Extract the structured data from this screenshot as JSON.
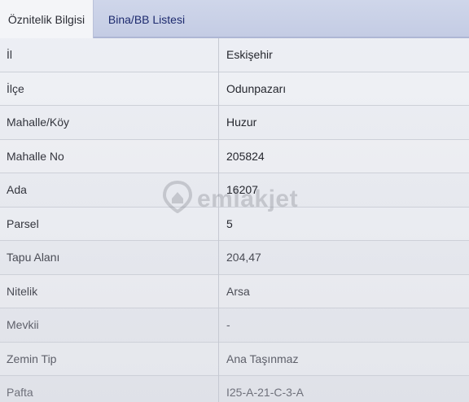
{
  "tabs": [
    {
      "label": "Öznitelik Bilgisi",
      "active": true
    },
    {
      "label": "Bina/BB Listesi",
      "active": false
    }
  ],
  "attributes": [
    {
      "label": "İl",
      "value": "Eskişehir"
    },
    {
      "label": "İlçe",
      "value": "Odunpazarı"
    },
    {
      "label": "Mahalle/Köy",
      "value": "Huzur"
    },
    {
      "label": "Mahalle No",
      "value": "205824"
    },
    {
      "label": "Ada",
      "value": "16207"
    },
    {
      "label": "Parsel",
      "value": "5"
    },
    {
      "label": "Tapu Alanı",
      "value": "204,47"
    },
    {
      "label": "Nitelik",
      "value": "Arsa"
    },
    {
      "label": "Mevkii",
      "value": "-"
    },
    {
      "label": "Zemin Tip",
      "value": "Ana Taşınmaz"
    },
    {
      "label": "Pafta",
      "value": "I25-A-21-C-3-A"
    }
  ],
  "watermark": {
    "text": "emlakjet",
    "icon": "house-pin-icon"
  },
  "colors": {
    "tab_bar": "#c4cce4",
    "active_tab": "#f4f5f8",
    "inactive_tab_text": "#1d2a6e"
  }
}
